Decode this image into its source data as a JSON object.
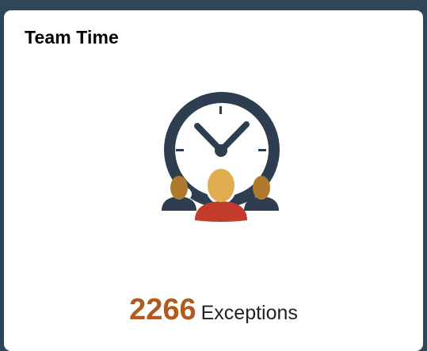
{
  "tile": {
    "title": "Team Time",
    "icon": "clock-with-team-icon",
    "count": "2266",
    "count_label": "Exceptions"
  },
  "colors": {
    "page_background": "#2f4558",
    "tile_background": "#ffffff",
    "count_color": "#b35a1f",
    "clock_ring": "#2c3e50",
    "person_center_head": "#e0ad4f",
    "person_center_body": "#c33b2b",
    "person_side_head": "#b07a2e",
    "person_side_body": "#2c3e50"
  }
}
